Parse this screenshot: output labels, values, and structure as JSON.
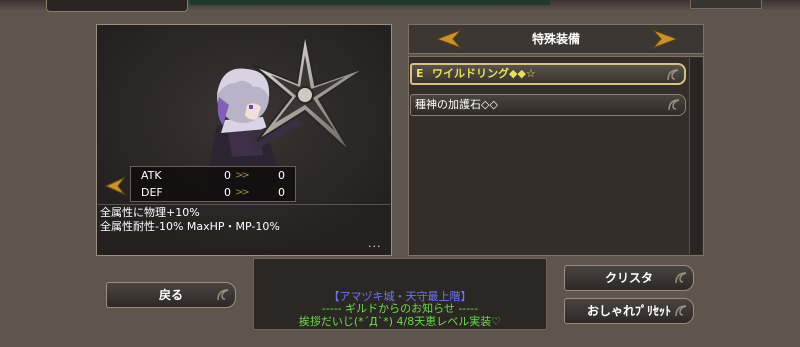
{
  "stats": {
    "rows": [
      {
        "label": "ATK",
        "current": "0",
        "next": "0"
      },
      {
        "label": "DEF",
        "current": "0",
        "next": "0"
      }
    ],
    "arrow": ">>"
  },
  "effects": {
    "line1": "全属性に物理+10%",
    "line2": "全属性耐性-10% MaxHP・MP-10%",
    "more": "..."
  },
  "equipment": {
    "title": "特殊装備",
    "items": [
      {
        "badge": "E",
        "name": "ワイルドリング◆◆☆",
        "selected": true
      },
      {
        "badge": "",
        "name": "種神の加護石◇◇",
        "selected": false
      }
    ]
  },
  "buttons": {
    "back": "戻る",
    "crysta": "クリスタ",
    "preset": "おしゃれﾌﾟﾘｾｯﾄ"
  },
  "news": {
    "line1": "【アマヅキ城・天守最上階】",
    "line2": "----- ギルドからのお知らせ -----",
    "line3": "挨拶だいじ(*´Д`*) 4/8天恵レベル実装♡"
  },
  "colors": {
    "selected_border": "#d7c280",
    "badge_yellow": "#e8e05a",
    "news_blue": "#6d77f0",
    "news_green": "#6bdb4a",
    "arrow_gold": "#c9922e"
  },
  "icons": [
    "left-arrow-icon",
    "right-arrow-icon",
    "ornament-swirl-icon",
    "shuriken-weapon"
  ]
}
